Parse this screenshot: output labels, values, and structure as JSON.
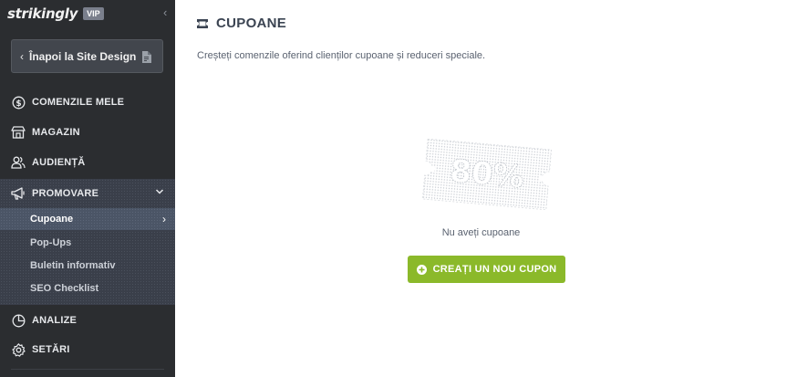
{
  "brand": {
    "logo": "strikingly",
    "badge": "VIP"
  },
  "sidebar": {
    "back_label": "Înapoi la Site Design",
    "items": [
      {
        "label": "COMENZILE MELE",
        "icon": "dollar-circle-icon"
      },
      {
        "label": "MAGAZIN",
        "icon": "store-icon"
      },
      {
        "label": "AUDIENȚĂ",
        "icon": "people-icon"
      },
      {
        "label": "PROMOVARE",
        "icon": "megaphone-icon",
        "expanded": true
      },
      {
        "label": "ANALIZE",
        "icon": "pie-chart-icon"
      },
      {
        "label": "SETĂRI",
        "icon": "gear-icon"
      }
    ],
    "promo_subitems": [
      {
        "label": "Cupoane",
        "active": true
      },
      {
        "label": "Pop-Ups"
      },
      {
        "label": "Buletin informativ"
      },
      {
        "label": "SEO Checklist"
      }
    ]
  },
  "main": {
    "title": "CUPOANE",
    "subtitle": "Creșteți comenzile oferind clienților cupoane și reduceri speciale.",
    "illustration_text": "80%",
    "empty_text": "Nu aveți cupoane",
    "create_button": "CREAȚI UN NOU CUPON"
  },
  "colors": {
    "sidebar_bg": "#2b2d30",
    "accent_green": "#8bb92a",
    "title": "#3b4452"
  }
}
